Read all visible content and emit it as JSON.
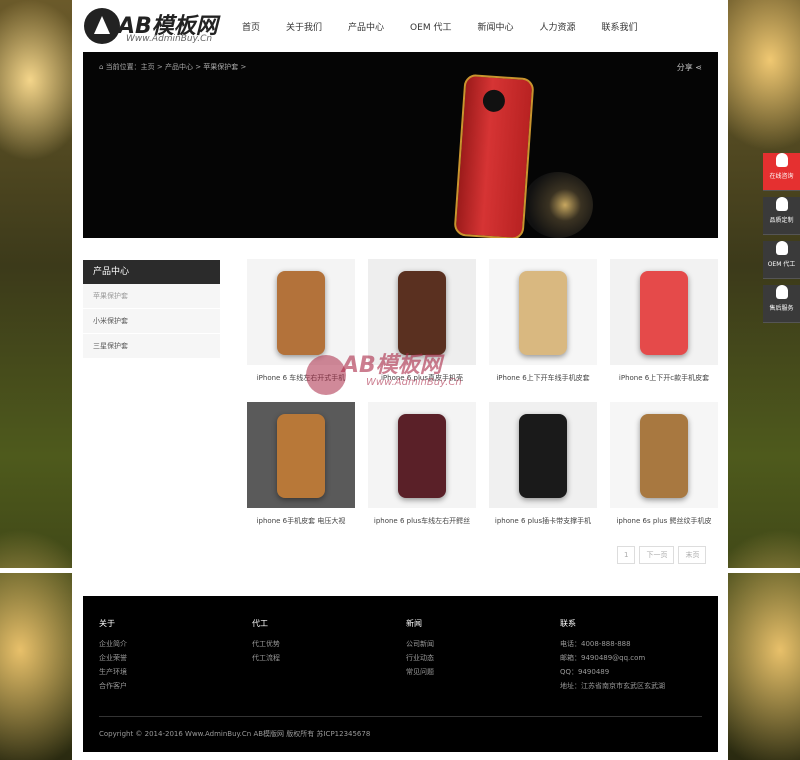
{
  "header": {
    "logo_text": "AB模板网",
    "logo_sub": "Www.AdminBuy.Cn",
    "nav": [
      "首页",
      "关于我们",
      "产品中心",
      "OEM 代工",
      "新闻中心",
      "人力资源",
      "联系我们"
    ]
  },
  "banner": {
    "breadcrumb": "当前位置：主页 > 产品中心 > 苹果保护套 >",
    "share": "分享"
  },
  "sidebar": {
    "title": "产品中心",
    "items": [
      "苹果保护套",
      "小米保护套",
      "三星保护套"
    ]
  },
  "products": [
    {
      "name": "iPhone 6 车线左右开式手机",
      "color": "#b3723a",
      "bg": "#f4f4f4"
    },
    {
      "name": "iPhone 6 plus真皮手机壳",
      "color": "#5a3020",
      "bg": "#eeeeee"
    },
    {
      "name": "iPhone 6上下开车线手机皮套",
      "color": "#d9b880",
      "bg": "#f6f6f6"
    },
    {
      "name": "iPhone 6上下开c款手机皮套",
      "color": "#e54a4a",
      "bg": "#f2f2f2"
    },
    {
      "name": "iphone 6手机皮套 电压大视",
      "color": "#b87838",
      "bg": "#5a5a5a"
    },
    {
      "name": "iphone 6 plus车线左右开鳄丝",
      "color": "#5a2028",
      "bg": "#f4f4f4"
    },
    {
      "name": "iphone 6 plus插卡带支撑手机",
      "color": "#1a1a1a",
      "bg": "#f0f0f0"
    },
    {
      "name": "iphone 6s plus 鳄丝纹手机皮",
      "color": "#a87840",
      "bg": "#f6f6f6"
    }
  ],
  "pager": [
    "1",
    "下一页",
    "末页"
  ],
  "footer": {
    "cols": [
      {
        "title": "关于",
        "links": [
          "企业简介",
          "企业荣誉",
          "生产环境",
          "合作客户"
        ]
      },
      {
        "title": "代工",
        "links": [
          "代工优势",
          "代工流程"
        ]
      },
      {
        "title": "新闻",
        "links": [
          "公司新闻",
          "行业动态",
          "常见问题"
        ]
      },
      {
        "title": "联系",
        "links": [
          "电话：4008-888-888",
          "邮箱：9490489@qq.com",
          "QQ：9490489",
          "地址：江苏省南京市玄武区玄武湖"
        ]
      }
    ],
    "copyright": "Copyright © 2014-2016 Www.AdminBuy.Cn AB模版网 版权所有  苏ICP12345678"
  },
  "sidetools": [
    "在线咨询",
    "品质定制",
    "OEM 代工",
    "售后服务"
  ],
  "watermark": {
    "text": "AB模板网",
    "sub": "Www.AdminBuy.Cn"
  }
}
